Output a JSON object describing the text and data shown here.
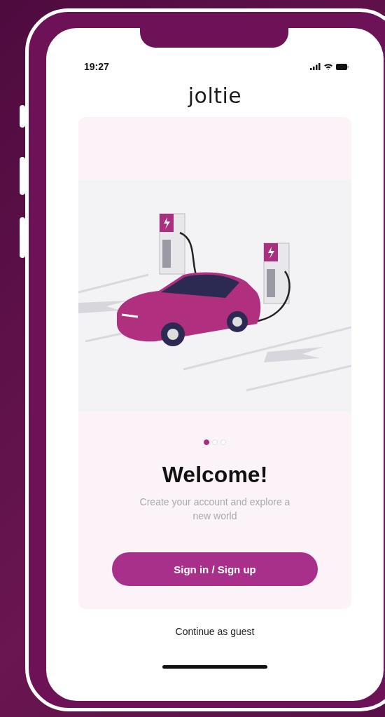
{
  "status_bar": {
    "time": "19:27"
  },
  "logo": "joltie",
  "onboarding": {
    "pages": [
      {
        "selected": true
      },
      {
        "selected": false
      },
      {
        "selected": false
      }
    ],
    "title": "Welcome!",
    "subtitle": "Create your account and explore a new world",
    "primary_button": "Sign in / Sign up"
  },
  "secondary_link": "Continue as guest"
}
